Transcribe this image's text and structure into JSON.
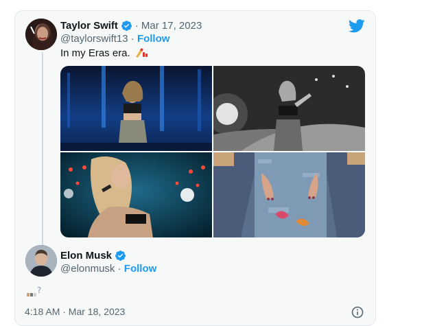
{
  "tweet": {
    "author_name": "Taylor Swift",
    "handle": "@taylorswift13",
    "separator": "·",
    "date": "Mar 17, 2023",
    "follow_label": "Follow",
    "text": "In my Eras era.",
    "emoji_icon": "nail-polish-icon",
    "verified_icon": "verified-badge-icon",
    "brand_icon": "twitter-bird-icon",
    "photos": [
      {
        "name": "photo-blue-stage"
      },
      {
        "name": "photo-bw-stage"
      },
      {
        "name": "photo-singing-red-lights"
      },
      {
        "name": "photo-denim-overalls"
      }
    ]
  },
  "reply": {
    "author_name": "Elon Musk",
    "handle": "@elonmusk",
    "separator": "·",
    "follow_label": "Follow",
    "text_icon": "missing-emoji-glyph",
    "timestamp": "4:18 AM · Mar 18, 2023"
  },
  "colors": {
    "accent": "#1d9bf0",
    "text": "#0f1419",
    "secondary": "#536471",
    "card_bg": "#f7f9f9",
    "thread_line": "#cfd9de"
  }
}
